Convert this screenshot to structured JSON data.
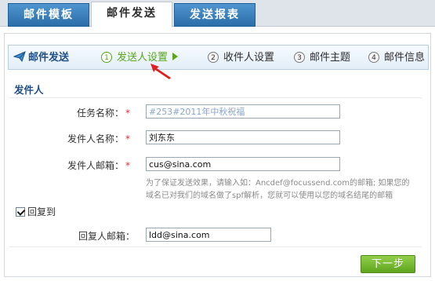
{
  "tabs": [
    {
      "label": "邮件模板"
    },
    {
      "label": "邮件发送"
    },
    {
      "label": "发送报表"
    }
  ],
  "steps": {
    "title": "邮件发送",
    "items": [
      {
        "num": "1",
        "label": "发送人设置"
      },
      {
        "num": "2",
        "label": "收件人设置"
      },
      {
        "num": "3",
        "label": "邮件主题"
      },
      {
        "num": "4",
        "label": "邮件信息"
      }
    ]
  },
  "section": {
    "title": "发件人"
  },
  "form": {
    "task_name_label": "任务名称：",
    "task_name_value": "#253#2011年中秋祝福",
    "sender_name_label": "发件人名称：",
    "sender_name_value": "刘东东",
    "sender_email_label": "发件人邮箱：",
    "sender_email_value": "cus@sina.com",
    "required_mark": "*",
    "hint": "为了保证发送效果，请输入如：Ancdef@focussend.com的邮箱; 如果您的域名已对我们的域名做了spf解析，您就可以使用以您的域名结尾的邮箱",
    "reply_checkbox_label": "回复到",
    "reply_email_label": "回复人邮箱：",
    "reply_email_value": "ldd@sina.com"
  },
  "next_button": "下一步",
  "colors": {
    "tab_blue": "#2b6ea9",
    "accent_green": "#5aa51a",
    "required_red": "#e03030",
    "pointer_red": "#e02020"
  }
}
